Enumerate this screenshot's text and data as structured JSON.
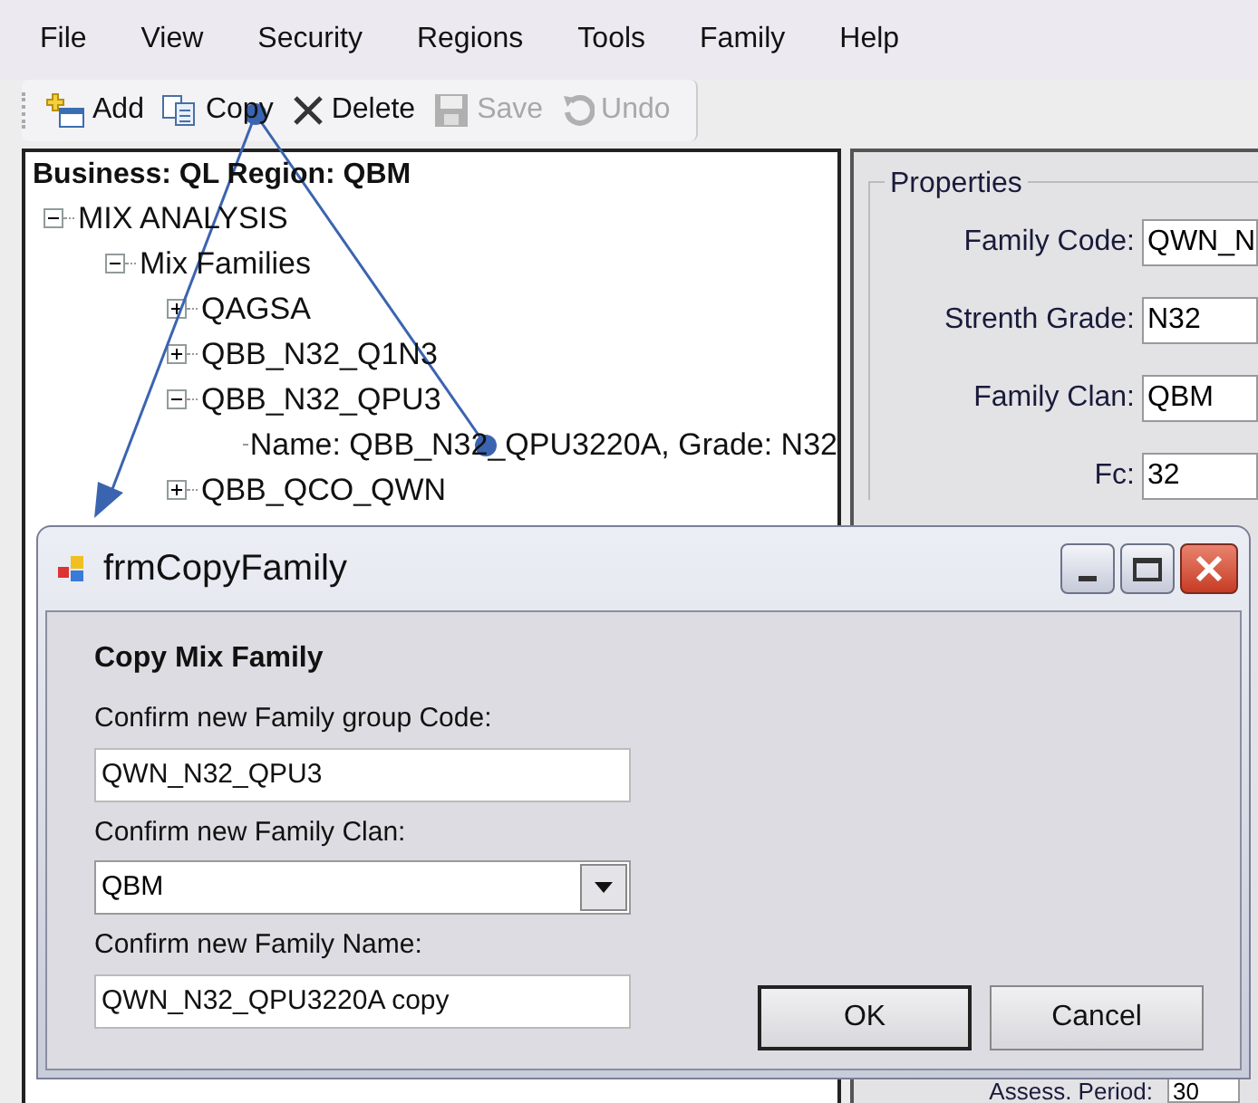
{
  "menu": [
    "File",
    "View",
    "Security",
    "Regions",
    "Tools",
    "Family",
    "Help"
  ],
  "toolbar": [
    {
      "kind": "add",
      "label": "Add",
      "disabled": false
    },
    {
      "kind": "copy",
      "label": "Copy",
      "disabled": false
    },
    {
      "kind": "delete",
      "label": "Delete",
      "disabled": false
    },
    {
      "kind": "save",
      "label": "Save",
      "disabled": true
    },
    {
      "kind": "undo",
      "label": "Undo",
      "disabled": true
    }
  ],
  "tree": {
    "header": "Business: QL  Region: QBM",
    "items": [
      {
        "label": "MIX ANALYSIS",
        "expanded": true,
        "children": [
          {
            "label": "Mix Families",
            "expanded": true,
            "children": [
              {
                "label": "QAGSA",
                "expanded": false
              },
              {
                "label": "QBB_N32_Q1N3",
                "expanded": false
              },
              {
                "label": "QBB_N32_QPU3",
                "expanded": true,
                "children": [
                  {
                    "label": "Name: QBB_N32_QPU3220A, Grade: N32"
                  }
                ]
              },
              {
                "label": "QBB_QCO_QWN",
                "expanded": false
              }
            ]
          }
        ]
      }
    ]
  },
  "properties": {
    "title": "Properties",
    "fields": [
      {
        "label": "Family Code:",
        "value": "QWN_N"
      },
      {
        "label": "Strenth Grade:",
        "value": "N32"
      },
      {
        "label": "Family Clan:",
        "value": "QBM"
      },
      {
        "label": "Fc:",
        "value": "32"
      }
    ],
    "bottom_field": {
      "label": "Assess. Period:",
      "value": "30"
    }
  },
  "dialog": {
    "title": "frmCopyFamily",
    "heading": "Copy Mix Family",
    "fields": [
      {
        "kind": "text",
        "label": "Confirm new Family group Code:",
        "value": "QWN_N32_QPU3"
      },
      {
        "kind": "dropdown",
        "label": "Confirm new Family Clan:",
        "value": "QBM"
      },
      {
        "kind": "text",
        "label": "Confirm new Family Name:",
        "value": "QWN_N32_QPU3220A copy"
      }
    ],
    "buttons": [
      {
        "label": "OK",
        "default": true
      },
      {
        "label": "Cancel",
        "default": false
      }
    ]
  }
}
